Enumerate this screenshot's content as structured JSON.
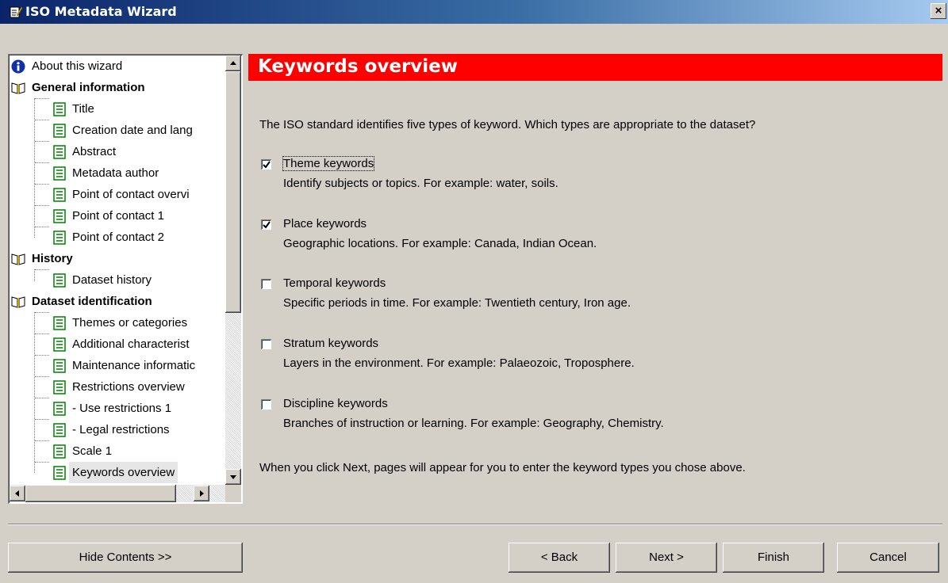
{
  "window": {
    "title": "ISO Metadata Wizard",
    "close_label": "×"
  },
  "tree": {
    "about": "About this wizard",
    "general": "General information",
    "title": "Title",
    "creation": "Creation date and lang",
    "abstract": "Abstract",
    "author": "Metadata author",
    "poc_overview": "Point of contact overvi",
    "poc1": "Point of contact 1",
    "poc2": "Point of contact 2",
    "history": "History",
    "dataset_history": "Dataset history",
    "dataset_id": "Dataset identification",
    "themes": "Themes or categories",
    "additional": "Additional characterist",
    "maintenance": "Maintenance informatic",
    "restrictions": "Restrictions overview",
    "use_restrictions": "- Use restrictions 1",
    "legal_restrictions": "- Legal restrictions",
    "scale": "Scale 1",
    "keywords_overview": "Keywords overview"
  },
  "page": {
    "heading": "Keywords overview",
    "intro": "The ISO standard identifies five types of keyword.  Which types are appropriate to the dataset?",
    "options": [
      {
        "label": "Theme keywords",
        "desc": "Identify subjects or topics.  For example: water, soils.",
        "checked": true
      },
      {
        "label": "Place keywords",
        "desc": "Geographic locations.  For example: Canada, Indian Ocean.",
        "checked": true
      },
      {
        "label": "Temporal keywords",
        "desc": "Specific periods in time.  For example: Twentieth century, Iron age.",
        "checked": false
      },
      {
        "label": "Stratum keywords",
        "desc": "Layers in the environment.  For example: Palaeozoic, Troposphere.",
        "checked": false
      },
      {
        "label": "Discipline keywords",
        "desc": "Branches of instruction or learning.  For example: Geography, Chemistry.",
        "checked": false
      }
    ],
    "footer_note": "When you click Next, pages will appear for you to enter the keyword types you chose above."
  },
  "buttons": {
    "hide_contents": "Hide Contents >>",
    "back": "< Back",
    "next": "Next >",
    "finish": "Finish",
    "cancel": "Cancel"
  }
}
